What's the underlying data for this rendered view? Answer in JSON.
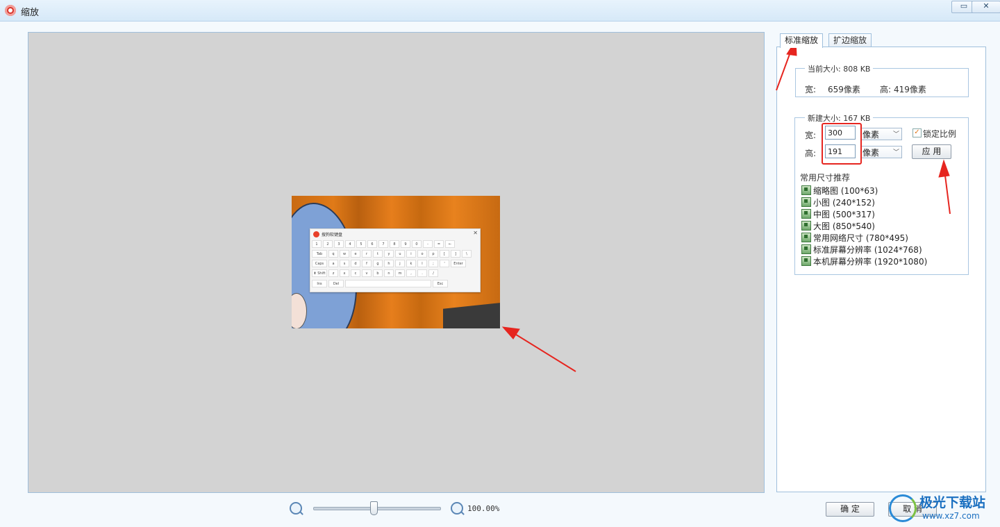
{
  "window": {
    "title": "缩放",
    "restore_glyph": "▭",
    "close_glyph": "✕"
  },
  "tabs": [
    {
      "label": "标准缩放"
    },
    {
      "label": "扩边缩放"
    }
  ],
  "current_size": {
    "legend": "当前大小: 808 KB",
    "width_label": "宽:",
    "width_value": "659像素",
    "height_label": "高:",
    "height_value": "419像素"
  },
  "new_size": {
    "legend": "新建大小: 167 KB",
    "width_label": "宽:",
    "width_value": "300",
    "height_label": "高:",
    "height_value": "191",
    "unit": "像素",
    "lock_ratio_label": "锁定比例",
    "lock_ratio_checked": true,
    "apply_label": "应 用"
  },
  "presets": {
    "heading": "常用尺寸推荐",
    "items": [
      "缩略图 (100*63)",
      "小图 (240*152)",
      "中图 (500*317)",
      "大图 (850*540)",
      "常用网络尺寸 (780*495)",
      "标准屏幕分辨率 (1024*768)",
      "本机屏幕分辨率 (1920*1080)"
    ]
  },
  "zoom": {
    "value_text": "100.00%",
    "slider_position": 0.47
  },
  "footer": {
    "ok_label": "确 定",
    "cancel_label": "取 消"
  },
  "preview": {
    "keyboard_title": "搜狗软键盘",
    "keys_row1": [
      "1",
      "2",
      "3",
      "4",
      "5",
      "6",
      "7",
      "8",
      "9",
      "0",
      "-",
      "=",
      "←"
    ],
    "keys_row2": [
      "Tab",
      "q",
      "w",
      "e",
      "r",
      "t",
      "y",
      "u",
      "i",
      "o",
      "p",
      "[",
      "]",
      "\\"
    ],
    "keys_row3": [
      "Caps",
      "a",
      "s",
      "d",
      "f",
      "g",
      "h",
      "j",
      "k",
      "l",
      ";",
      "'",
      "Enter"
    ],
    "keys_row4": [
      "⬆ Shift",
      "z",
      "x",
      "c",
      "v",
      "b",
      "n",
      "m",
      ",",
      ".",
      "/"
    ],
    "keys_row5": [
      "Ins",
      "Del",
      "",
      "Esc"
    ]
  },
  "watermark": {
    "title": "极光下载站",
    "url": "www.xz7.com"
  },
  "colors": {
    "accent_border": "#9fbfdc",
    "annotation_red": "#e6251f",
    "canvas_bg": "#d3d3d3"
  }
}
